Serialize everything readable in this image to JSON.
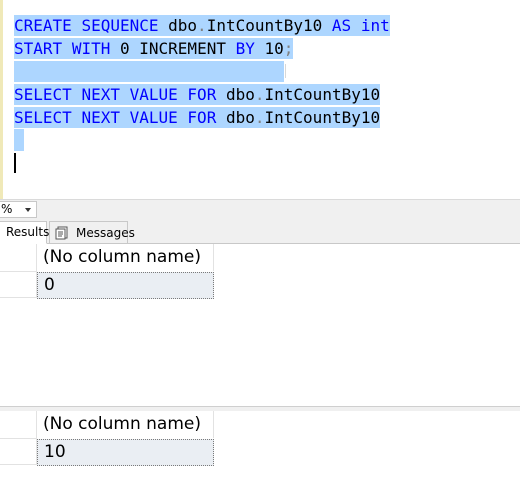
{
  "editor": {
    "lines": [
      {
        "tokens": [
          {
            "t": "CREATE",
            "c": "kw"
          },
          {
            "t": " ",
            "c": "ident"
          },
          {
            "t": "SEQUENCE",
            "c": "kw"
          },
          {
            "t": " ",
            "c": "ident"
          },
          {
            "t": "dbo",
            "c": "ident"
          },
          {
            "t": ".",
            "c": "punct"
          },
          {
            "t": "IntCountBy10",
            "c": "ident"
          },
          {
            "t": " ",
            "c": "ident"
          },
          {
            "t": "AS",
            "c": "kw"
          },
          {
            "t": " ",
            "c": "ident"
          },
          {
            "t": "int",
            "c": "kw"
          }
        ]
      },
      {
        "tokens": [
          {
            "t": "START",
            "c": "kw"
          },
          {
            "t": " ",
            "c": "ident"
          },
          {
            "t": "WITH",
            "c": "kw"
          },
          {
            "t": " ",
            "c": "ident"
          },
          {
            "t": "0",
            "c": "num"
          },
          {
            "t": " ",
            "c": "ident"
          },
          {
            "t": "INCREMENT",
            "c": "ident"
          },
          {
            "t": " ",
            "c": "ident"
          },
          {
            "t": "BY",
            "c": "kw"
          },
          {
            "t": " ",
            "c": "ident"
          },
          {
            "t": "10",
            "c": "num"
          },
          {
            "t": ";",
            "c": "punct"
          }
        ]
      },
      {
        "tokens": []
      },
      {
        "tokens": [
          {
            "t": "SELECT",
            "c": "kw"
          },
          {
            "t": " ",
            "c": "ident"
          },
          {
            "t": "NEXT",
            "c": "kw"
          },
          {
            "t": " ",
            "c": "ident"
          },
          {
            "t": "VALUE",
            "c": "kw"
          },
          {
            "t": " ",
            "c": "ident"
          },
          {
            "t": "FOR",
            "c": "kw"
          },
          {
            "t": " ",
            "c": "ident"
          },
          {
            "t": "dbo",
            "c": "ident"
          },
          {
            "t": ".",
            "c": "punct"
          },
          {
            "t": "IntCountBy10",
            "c": "ident"
          }
        ]
      },
      {
        "tokens": [
          {
            "t": "SELECT",
            "c": "kw"
          },
          {
            "t": " ",
            "c": "ident"
          },
          {
            "t": "NEXT",
            "c": "kw"
          },
          {
            "t": " ",
            "c": "ident"
          },
          {
            "t": "VALUE",
            "c": "kw"
          },
          {
            "t": " ",
            "c": "ident"
          },
          {
            "t": "FOR",
            "c": "kw"
          },
          {
            "t": " ",
            "c": "ident"
          },
          {
            "t": "dbo",
            "c": "ident"
          },
          {
            "t": ".",
            "c": "punct"
          },
          {
            "t": "IntCountBy10",
            "c": "ident"
          }
        ]
      }
    ],
    "colors": {
      "keyword": "#0000ff",
      "selection": "#add6ff"
    }
  },
  "zoom": {
    "value": "%"
  },
  "tabs": {
    "results_label": "Results",
    "messages_label": "Messages",
    "messages_icon": "messages-icon"
  },
  "results": [
    {
      "column_header": "(No column name)",
      "rows": [
        "0"
      ]
    },
    {
      "column_header": "(No column name)",
      "rows": [
        "10"
      ]
    }
  ]
}
